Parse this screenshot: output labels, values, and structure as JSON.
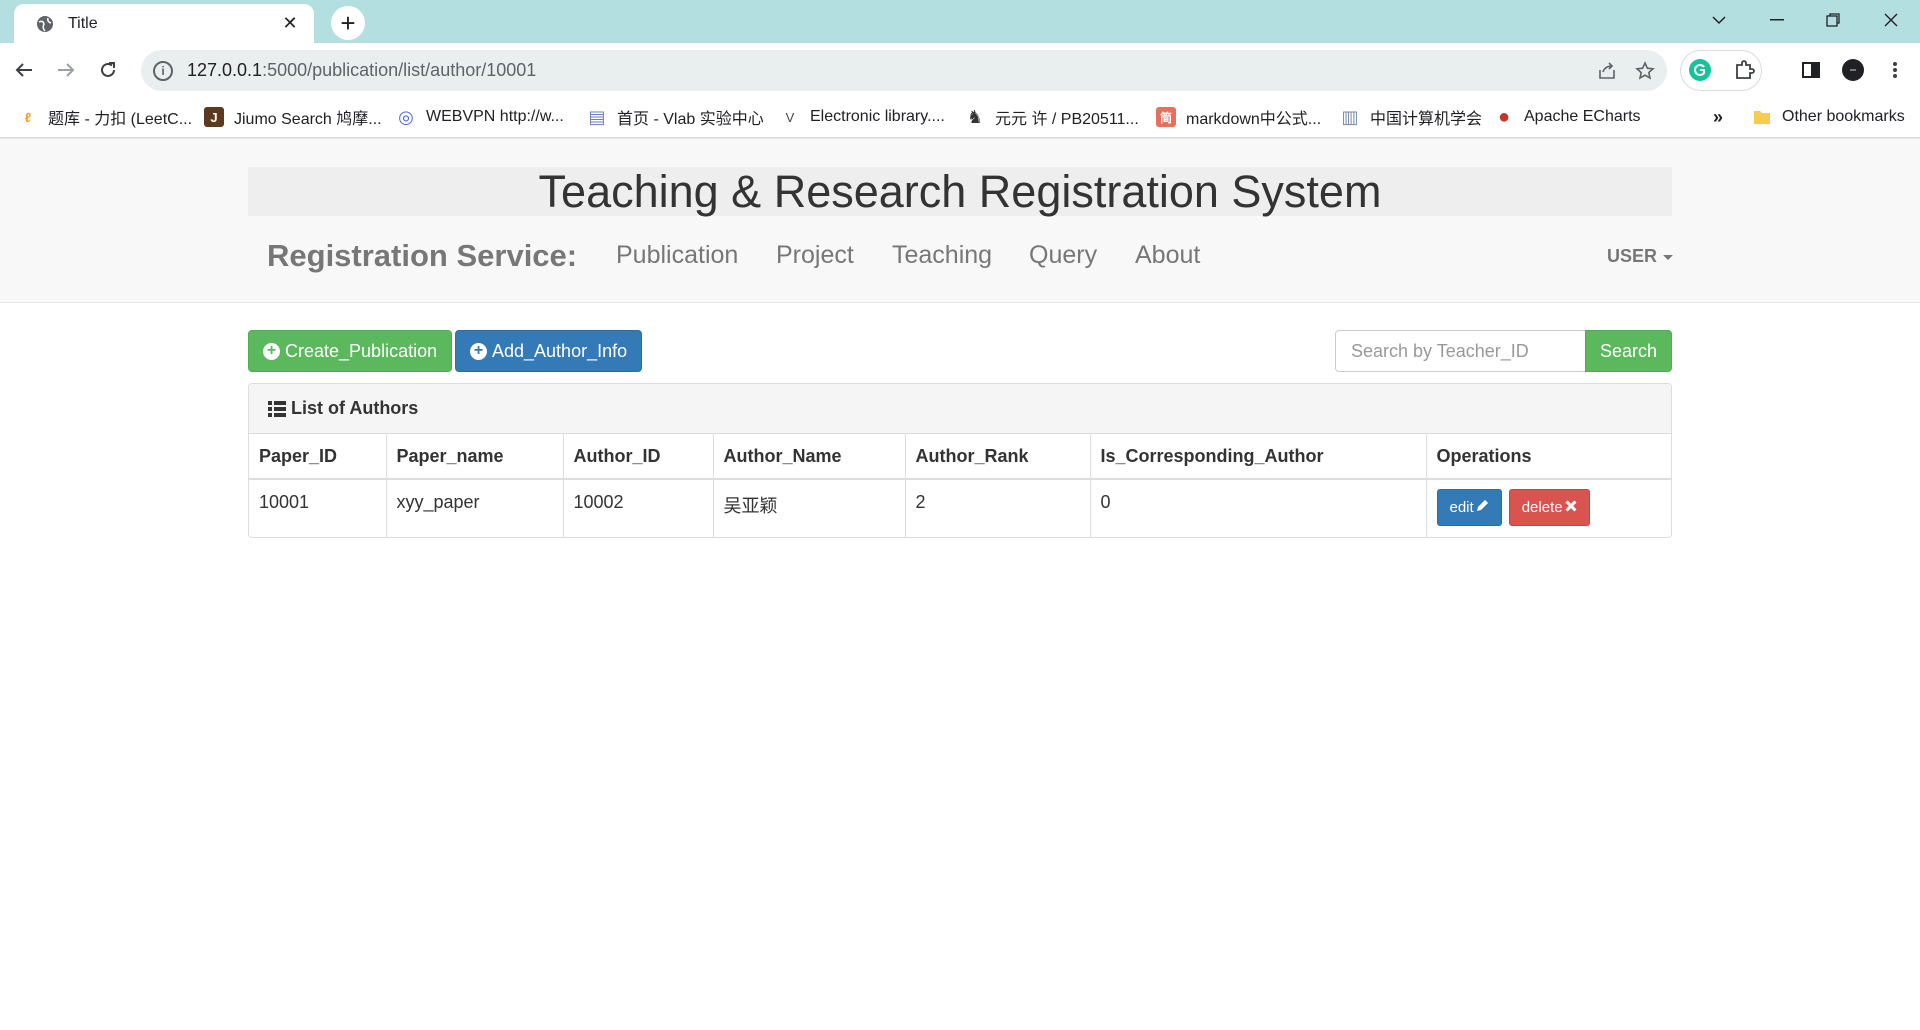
{
  "browser": {
    "tab_title": "Title",
    "tab_close": "✕",
    "new_tab": "+",
    "url_host": "127.0.0.1",
    "url_path": ":5000/publication/list/author/10001",
    "bookmarks": [
      {
        "label": "题库 - 力扣 (LeetC...",
        "icon": "leetcode-icon",
        "glyph": "ℓ",
        "color": "#f89f1b"
      },
      {
        "label": "Jiumo Search 鸠摩...",
        "icon": "jiumo-icon",
        "glyph": "J",
        "color": "#5b3a1e"
      },
      {
        "label": "WEBVPN http://w...",
        "icon": "webvpn-icon",
        "glyph": "◎",
        "color": "#4a6fd6"
      },
      {
        "label": "首页 - Vlab 实验中心",
        "icon": "vlab-icon",
        "glyph": "▤",
        "color": "#6d7fb3"
      },
      {
        "label": "Electronic library....",
        "icon": "elibrary-icon",
        "glyph": "V",
        "color": "#444444"
      },
      {
        "label": "元元 许 / PB20511...",
        "icon": "gitlab-icon",
        "glyph": "♞",
        "color": "#333333"
      },
      {
        "label": "markdown中公式...",
        "icon": "jianshu-icon",
        "glyph": "简",
        "color": "#ea6f5a"
      },
      {
        "label": "中国计算机学会",
        "icon": "ccf-icon",
        "glyph": "▥",
        "color": "#7a8aa8"
      },
      {
        "label": "Apache ECharts",
        "icon": "echarts-icon",
        "glyph": "●",
        "color": "#c23531"
      }
    ],
    "more_bookmarks": "»",
    "other_bookmarks": "Other bookmarks"
  },
  "header": {
    "title": "Teaching & Research Registration System",
    "brand": "Registration Service:",
    "nav": [
      "Publication",
      "Project",
      "Teaching",
      "Query",
      "About"
    ],
    "user": "USER"
  },
  "actions": {
    "create": "Create_Publication",
    "add_author": "Add_Author_Info",
    "search_placeholder": "Search by Teacher_ID",
    "search_button": "Search"
  },
  "panel": {
    "title": "List of Authors",
    "columns": [
      "Paper_ID",
      "Paper_name",
      "Author_ID",
      "Author_Name",
      "Author_Rank",
      "Is_Corresponding_Author",
      "Operations"
    ],
    "rows": [
      {
        "paper_id": "10001",
        "paper_name": "xyy_paper",
        "author_id": "10002",
        "author_name": "吴亚颖",
        "author_rank": "2",
        "is_corresponding": "0"
      }
    ],
    "edit_label": "edit",
    "delete_label": "delete"
  },
  "colors": {
    "success": "#5cb85c",
    "primary": "#337ab7",
    "danger": "#d9534f",
    "tabbar": "#b4dfe0"
  }
}
